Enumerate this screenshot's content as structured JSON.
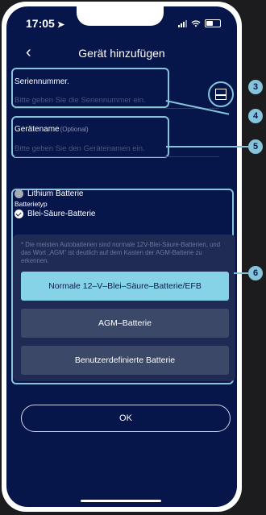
{
  "status_bar": {
    "time": "17:05",
    "location_arrow": "➤"
  },
  "nav": {
    "back_icon": "‹",
    "title": "Gerät hinzufügen"
  },
  "serial": {
    "label": "Seriennummer.",
    "placeholder": "Bitte geben Sie die Seriennummer ein."
  },
  "device_name": {
    "label": "Gerätename",
    "optional": "(Optional)",
    "placeholder": "Bitte geben Sie den Gerätenamen ein."
  },
  "battery": {
    "section_label": "Batterietyp",
    "options": [
      {
        "label": "Lithium Batterie",
        "selected": false
      },
      {
        "label": "Blei-Säure-Batterie",
        "selected": true
      }
    ],
    "note": "* Die meisten Autobatterien sind normale 12V-Blei-Säure-Batterien, und das Wort „AGM“ ist deutlich auf dem Kasten der AGM-Batterie zu erkennen.",
    "buttons": [
      {
        "label": "Normale 12–V–Blei–Säure–Batterie/EFB",
        "selected": true
      },
      {
        "label": "AGM–Batterie",
        "selected": false
      },
      {
        "label": "Benutzerdefinierte Batterie",
        "selected": false
      }
    ]
  },
  "ok_label": "OK",
  "callouts": [
    "3",
    "4",
    "5",
    "6"
  ],
  "colors": {
    "background": "#07164a",
    "accent": "#85c4da",
    "selected_button": "#86d3e8"
  }
}
